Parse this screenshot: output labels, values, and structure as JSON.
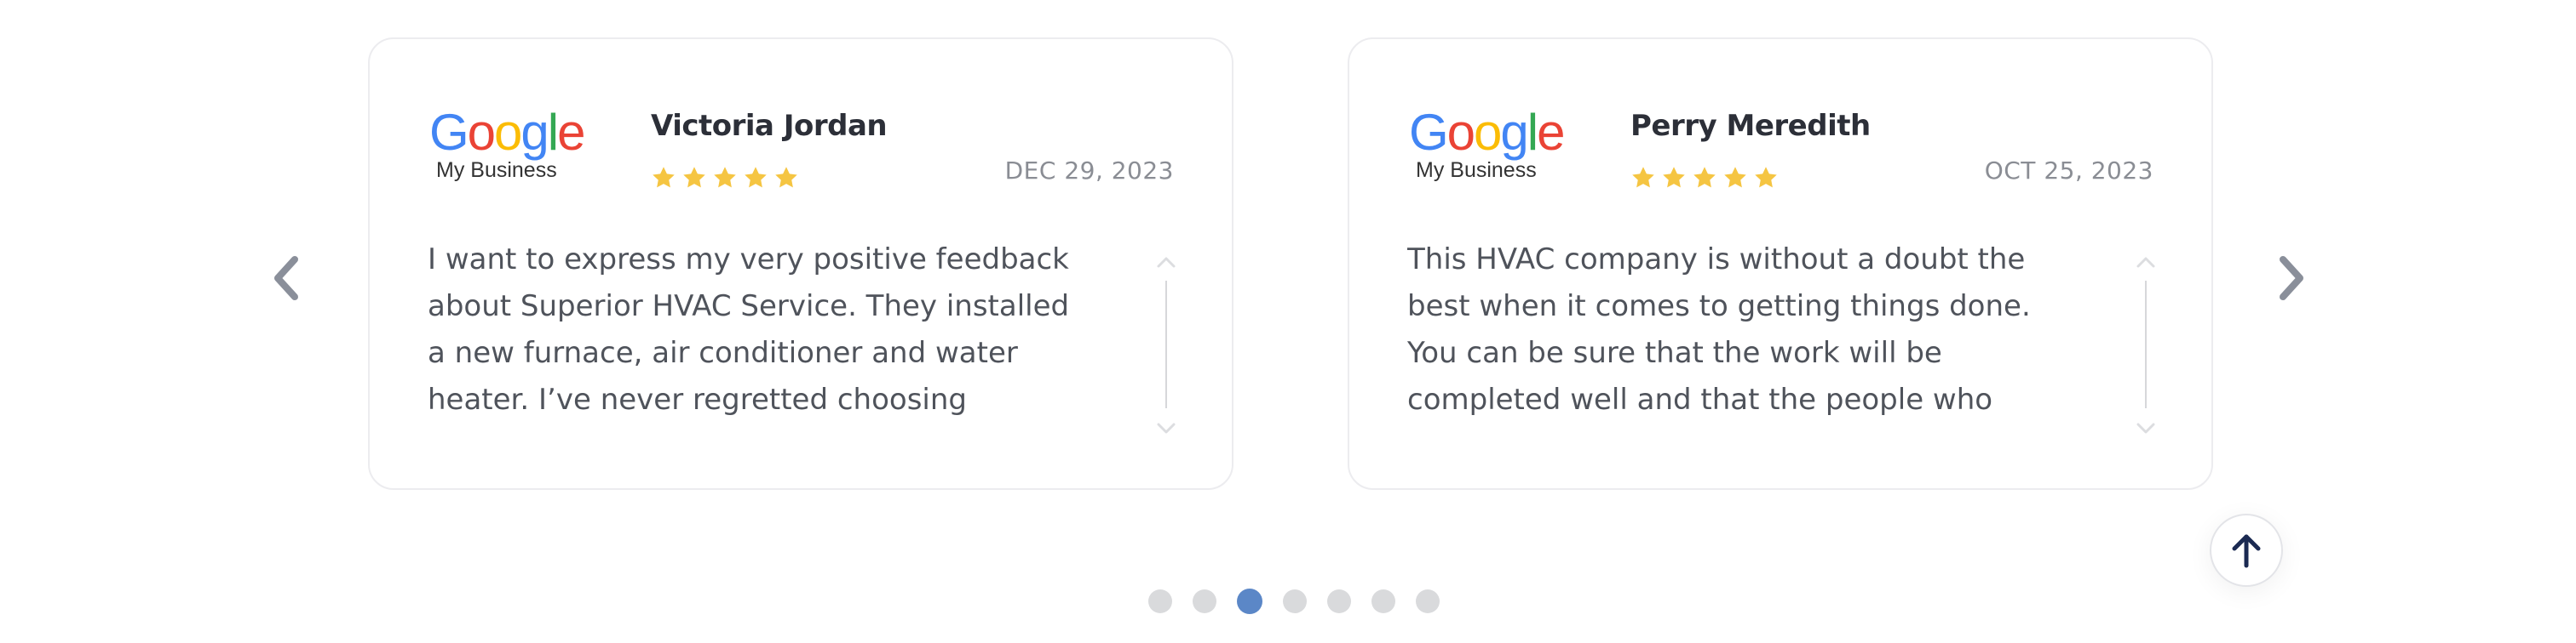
{
  "carousel": {
    "prev_icon": "chevron-left-icon",
    "next_icon": "chevron-right-icon",
    "active_index": 2,
    "dot_count": 7
  },
  "reviews": [
    {
      "platform": {
        "brand": "Google",
        "product": "My Business"
      },
      "name": "Victoria Jordan",
      "rating": 5,
      "date": "DEC 29, 2023",
      "text": "I want to express my very positive feedback about Superior HVAC Service. They installed a new furnace, air conditioner and water heater. I’ve never regretted choosing"
    },
    {
      "platform": {
        "brand": "Google",
        "product": "My Business"
      },
      "name": "Perry Meredith",
      "rating": 5,
      "date": "OCT 25, 2023",
      "text": "This HVAC company is without a doubt the best when it comes to getting things done. You can be sure that the work will be completed well and that the people who"
    }
  ],
  "back_to_top": {
    "icon": "arrow-up-icon"
  },
  "colors": {
    "star": "#f5c542",
    "active_dot": "#5b87c7",
    "inactive_dot": "#d9dadc",
    "google_blue": "#4285F4",
    "google_red": "#EA4335",
    "google_yellow": "#FBBC05",
    "google_green": "#34A853"
  }
}
